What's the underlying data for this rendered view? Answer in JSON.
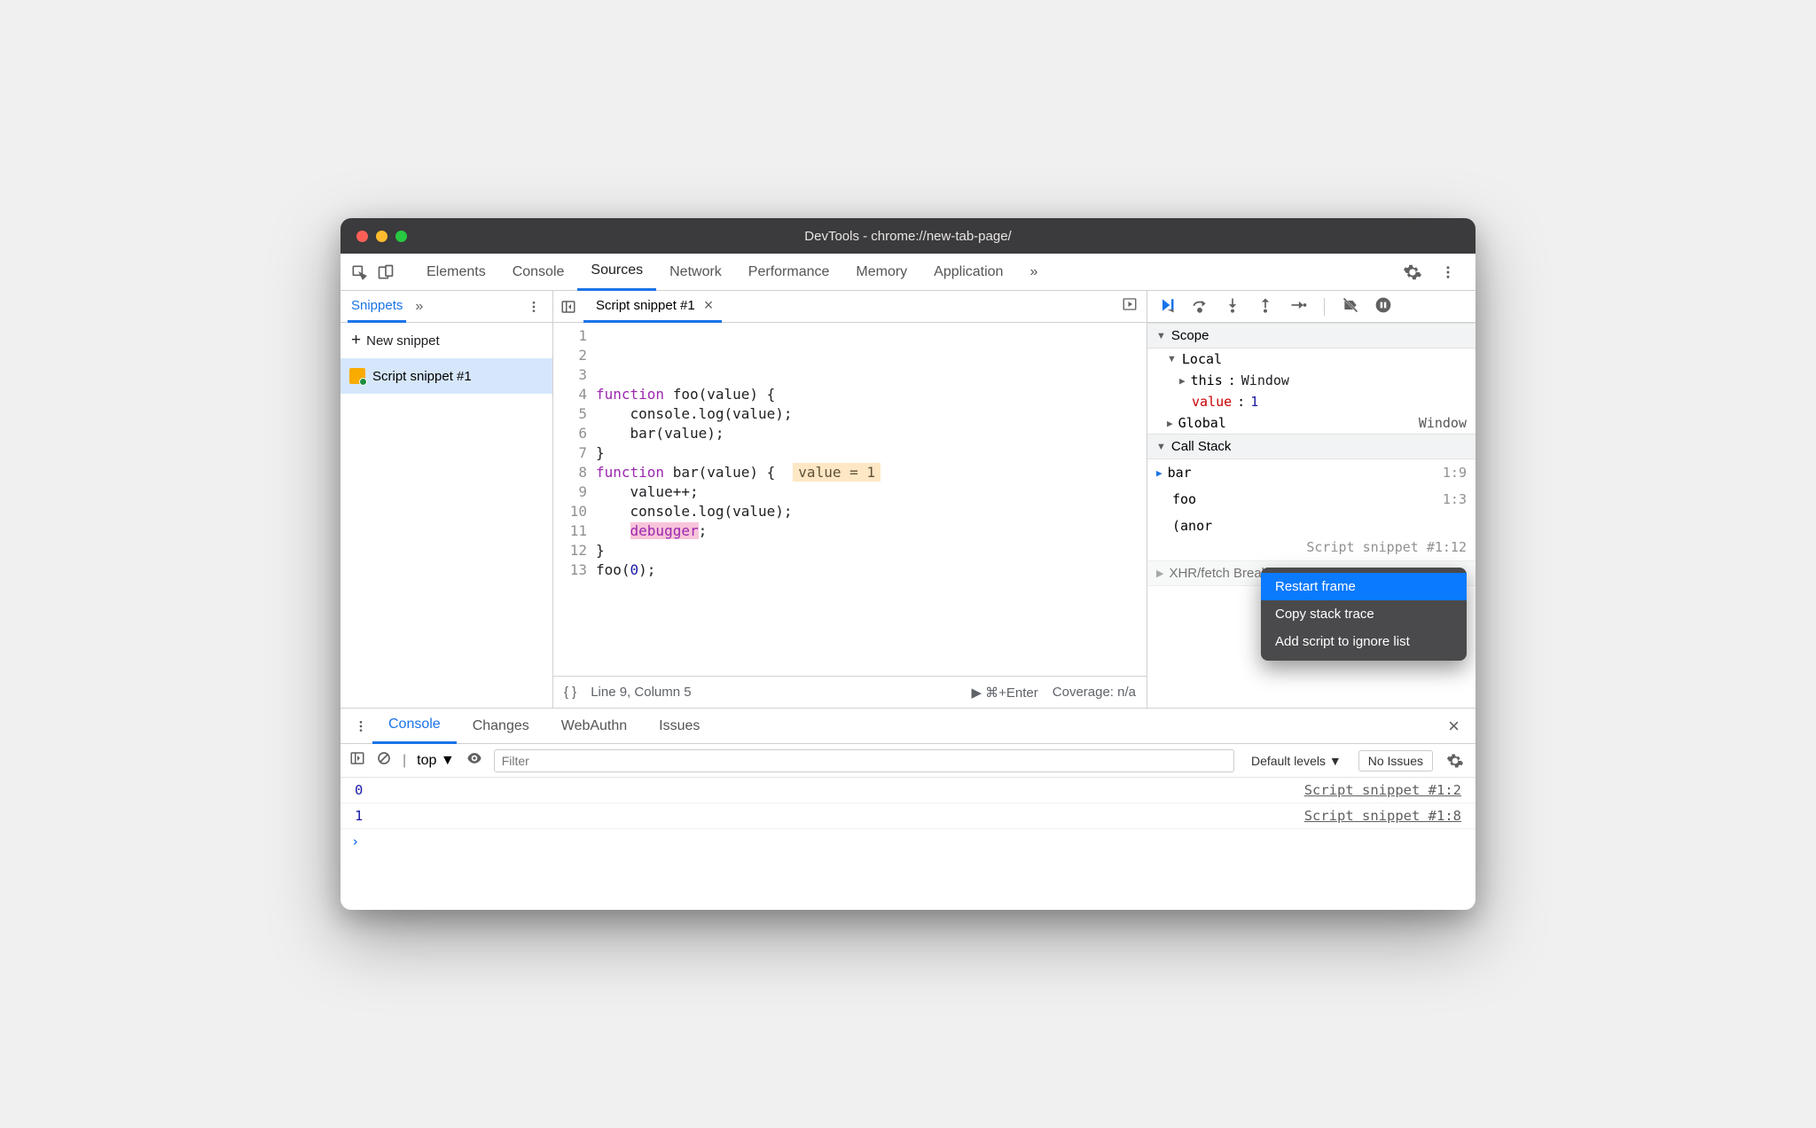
{
  "title": "DevTools - chrome://new-tab-page/",
  "mainTabs": [
    "Elements",
    "Console",
    "Sources",
    "Network",
    "Performance",
    "Memory",
    "Application"
  ],
  "sidebar": {
    "tab": "Snippets",
    "newSnippet": "New snippet",
    "items": [
      "Script snippet #1"
    ]
  },
  "editor": {
    "tab": "Script snippet #1",
    "lines": [
      {
        "n": 1,
        "tokens": [
          [
            "kw",
            "function"
          ],
          [
            "",
            " foo(value) {"
          ]
        ]
      },
      {
        "n": 2,
        "tokens": [
          [
            "",
            "    console.log(value);"
          ]
        ]
      },
      {
        "n": 3,
        "tokens": [
          [
            "",
            "    bar(value);"
          ]
        ]
      },
      {
        "n": 4,
        "tokens": [
          [
            "",
            "}"
          ]
        ]
      },
      {
        "n": 5,
        "tokens": [
          [
            "",
            ""
          ]
        ]
      },
      {
        "n": 6,
        "tokens": [
          [
            "kw",
            "function"
          ],
          [
            "",
            " bar(value) {"
          ]
        ],
        "hint": "value = 1"
      },
      {
        "n": 7,
        "tokens": [
          [
            "",
            "    value++;"
          ]
        ]
      },
      {
        "n": 8,
        "tokens": [
          [
            "",
            "    console.log(value);"
          ]
        ]
      },
      {
        "n": 9,
        "tokens": [
          [
            "",
            "    "
          ],
          [
            "dbg",
            "debugger"
          ],
          [
            "",
            ";"
          ]
        ]
      },
      {
        "n": 10,
        "tokens": [
          [
            "",
            "}"
          ]
        ]
      },
      {
        "n": 11,
        "tokens": [
          [
            "",
            ""
          ]
        ]
      },
      {
        "n": 12,
        "tokens": [
          [
            "",
            "foo("
          ],
          [
            "num",
            "0"
          ],
          [
            "",
            ");"
          ]
        ]
      },
      {
        "n": 13,
        "tokens": [
          [
            "",
            ""
          ]
        ]
      }
    ],
    "status": {
      "pos": "Line 9, Column 5",
      "run": "⌘+Enter",
      "coverage": "Coverage: n/a"
    }
  },
  "debugger": {
    "scope": {
      "header": "Scope",
      "local": {
        "label": "Local",
        "this": {
          "k": "this",
          "v": "Window"
        },
        "value": {
          "k": "value",
          "v": "1"
        }
      },
      "global": {
        "label": "Global",
        "val": "Window"
      }
    },
    "callstack": {
      "header": "Call Stack",
      "frames": [
        {
          "fn": "bar",
          "loc": "1:9"
        },
        {
          "fn": "foo",
          "loc": "1:3"
        },
        {
          "fn": "(anor",
          "loc2": "Script snippet #1:12"
        }
      ]
    },
    "xhr": "XHR/fetch Breakpoints"
  },
  "contextMenu": [
    "Restart frame",
    "Copy stack trace",
    "Add script to ignore list"
  ],
  "drawer": {
    "tabs": [
      "Console",
      "Changes",
      "WebAuthn",
      "Issues"
    ],
    "filterPlaceholder": "Filter",
    "levels": "Default levels",
    "noIssues": "No Issues",
    "context": "top",
    "rows": [
      {
        "v": "0",
        "loc": "Script snippet #1:2"
      },
      {
        "v": "1",
        "loc": "Script snippet #1:8"
      }
    ]
  }
}
